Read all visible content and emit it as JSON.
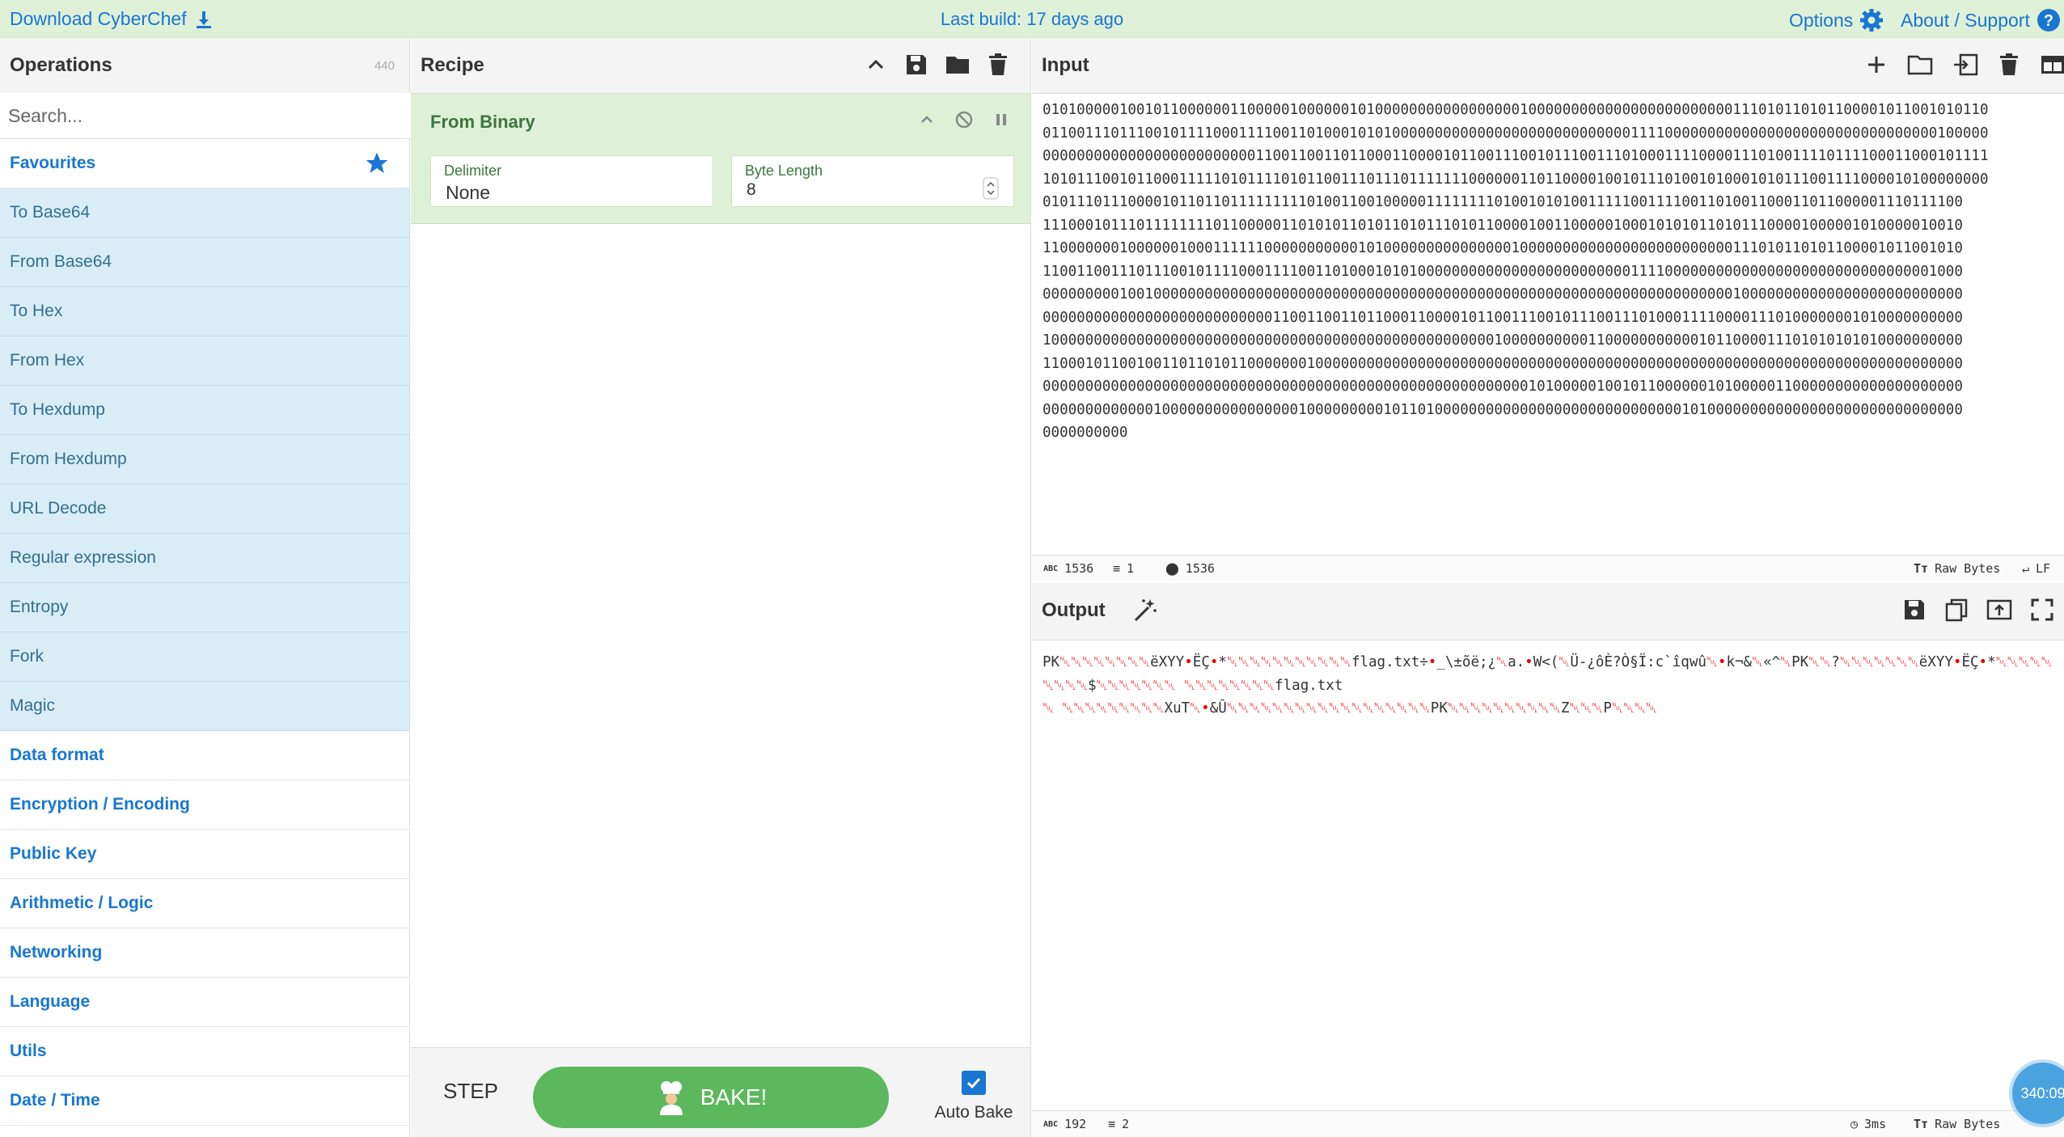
{
  "banner": {
    "download_label": "Download CyberChef",
    "last_build": "Last build: 17 days ago",
    "options_label": "Options",
    "about_label": "About / Support"
  },
  "operations": {
    "title": "Operations",
    "count": "440",
    "search_placeholder": "Search...",
    "favourites_label": "Favourites",
    "favourite_items": [
      "To Base64",
      "From Base64",
      "To Hex",
      "From Hex",
      "To Hexdump",
      "From Hexdump",
      "URL Decode",
      "Regular expression",
      "Entropy",
      "Fork",
      "Magic"
    ],
    "categories": [
      "Data format",
      "Encryption / Encoding",
      "Public Key",
      "Arithmetic / Logic",
      "Networking",
      "Language",
      "Utils",
      "Date / Time"
    ]
  },
  "recipe": {
    "title": "Recipe",
    "operation_name": "From Binary",
    "delimiter_label": "Delimiter",
    "delimiter_value": "None",
    "byte_length_label": "Byte Length",
    "byte_length_value": "8",
    "step_label": "STEP",
    "bake_label": "BAKE!",
    "auto_bake_label": "Auto Bake",
    "auto_bake_checked": true
  },
  "input": {
    "title": "Input",
    "lines": [
      "010100000100101100000011000001000000101000000000000000001000000000000000000000000111010110101100001011001010110",
      "011001110111001011110001111001101000101010000000000000000000000000000111100000000000000000000000000000000100000",
      "000000000000000000000000011001100110110001100001011001110010111001110100011110000111010011110111100011000101111",
      "101011100101100011111010111101011001110111011111110000001101100001001011101001010001010111001111000010100000000",
      "010111011100001011011011111111101001100100000111111110100101010011111001111001101001100011011000001110111100",
      "111000101110111111110110000011010101101011010111010110000100110000010001010101101011100001000001010000010010",
      "110000000100000010001111110000000000010100000000000000010000000000000000000000000111010110101100001011001010",
      "110011001110111001011110001111001101000101010000000000000000000000000111100000000000000000000000000000001000",
      "000000000100100000000000000000000000000000000000000000000000000000000000000000000100000000000000000000000000",
      "000000000000000000000000000110011001101100011000010110011100101110011101000111100001110100000001010000000000",
      "100000000000000000000000000000000000000000000000000001000000000011000000000001011000011101010101010000000000",
      "110001011001001101101011000000010000000000000000000000000000000000000000000000000000000000000000000000000000",
      "000000000000000000000000000000000000000000000000000000000101000001001011000000101000001100000000000000000000",
      "000000000000010000000000000000100000000010110100000000000000000000000000000101000000000000000000000000000000",
      "0000000000"
    ],
    "status_chars": "1536",
    "status_lines": "1",
    "status_pos": "1536",
    "raw_bytes_label": "Raw Bytes",
    "eol_label": "LF"
  },
  "output": {
    "title": "Output",
    "lines": [
      "PK␀␀␀␀␀␀␀␀ëXYY•ËÇ•*␀␀␀␀␀␀␀␀␀␀␀flag.txt÷•_\\±õë;¿␀a.•W<(␀Ü-¿ôÈ?Ò§Ï:c`îqwû␀•k¬&␀«^␀PK␀␀?␀␀␀␀␀␀␀ëXYY•ËÇ•*␀␀␀␀␀",
      "␀␀␀␀$␀␀␀␀␀␀␀ ␀␀␀␀␀␀␀␀flag.txt",
      "␀ ␀␀␀␀␀␀␀␀␀XuT␀•&Û␀␀␀␀␀␀␀␀␀␀␀␀␀␀␀␀␀␀PK␀␀␀␀␀␀␀␀␀␀Z␀␀␀P␀␀␀␀"
    ],
    "status_chars": "192",
    "status_lines": "2",
    "time_label": "3ms",
    "raw_bytes_label": "Raw Bytes"
  },
  "clock_badge": "340:09",
  "colors": {
    "accent": "#1976d2",
    "bake": "#5cb85c",
    "recipe_bg": "#dff0d8",
    "fav_bg": "#d9edf7"
  }
}
